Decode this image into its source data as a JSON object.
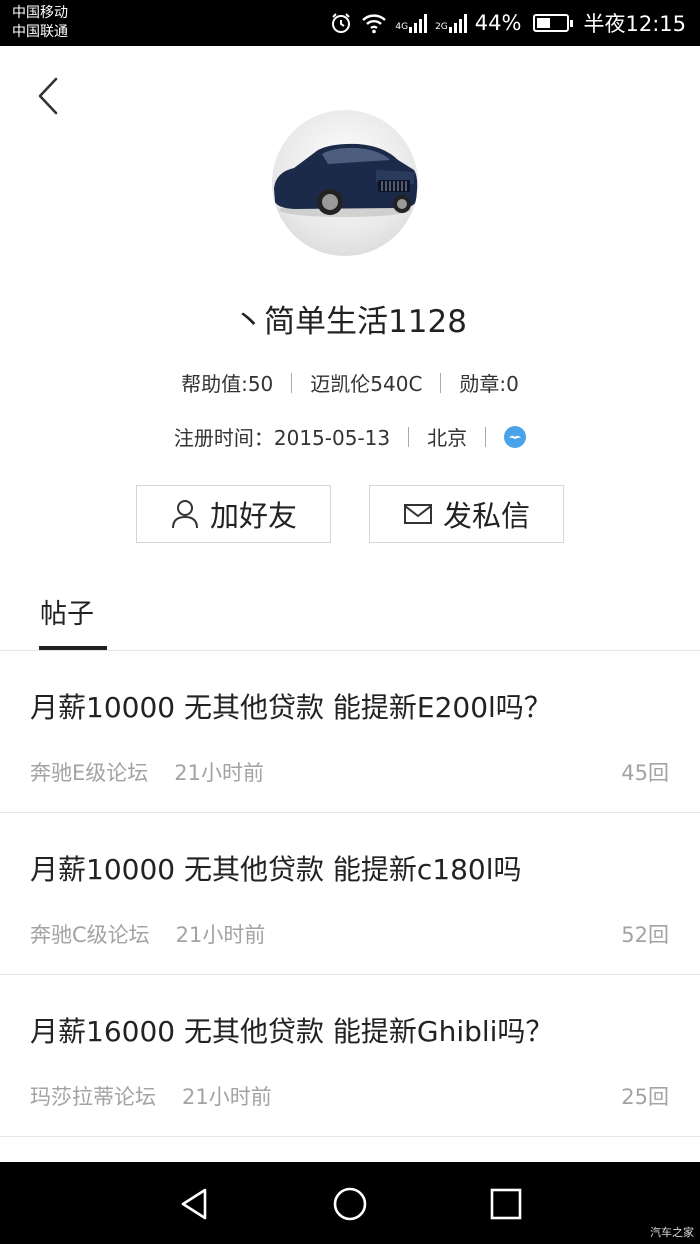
{
  "status_bar": {
    "carrier_1": "中国移动",
    "carrier_2": "中国联通",
    "net_1": "4G",
    "net_2": "2G",
    "battery_text": "44%",
    "battery_level": 0.44,
    "time": "半夜12:15"
  },
  "profile": {
    "username": "丶简单生活1128",
    "help_value": "帮助值:50",
    "car": "迈凯伦540C",
    "medals": "勋章:0",
    "register_time": "注册时间：2015-05-13",
    "city": "北京"
  },
  "actions": {
    "add_friend": "加好友",
    "send_message": "发私信"
  },
  "tabs": [
    {
      "label": "帖子"
    }
  ],
  "posts": [
    {
      "title": "月薪10000 无其他贷款 能提新E200l吗？",
      "forum": "奔驰E级论坛",
      "time": "21小时前",
      "replies": "45回"
    },
    {
      "title": "月薪10000 无其他贷款 能提新c180l吗",
      "forum": "奔驰C级论坛",
      "time": "21小时前",
      "replies": "52回"
    },
    {
      "title": "月薪16000 无其他贷款 能提新Ghibli吗？",
      "forum": "玛莎拉蒂论坛",
      "time": "21小时前",
      "replies": "25回"
    }
  ],
  "watermark": "汽车之家",
  "colors": {
    "accent_badge": "#4aa3e8",
    "meta_gray": "#a3a3a3"
  }
}
